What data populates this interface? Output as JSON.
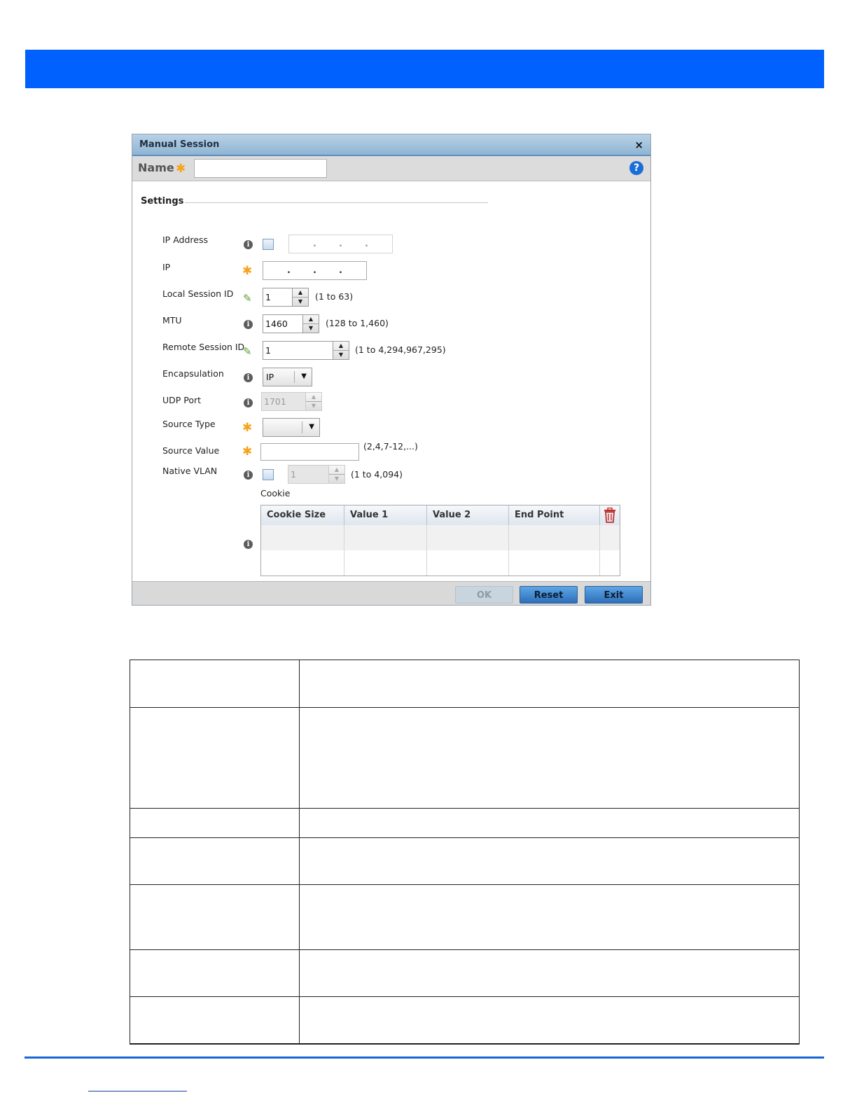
{
  "dialog": {
    "title": "Manual Session",
    "close_glyph": "×",
    "name_label": "Name",
    "name_value": "",
    "help_glyph": "?",
    "settings_label": "Settings"
  },
  "fields": {
    "ip_address": {
      "label": "IP Address",
      "checked": false
    },
    "ip": {
      "label": "IP"
    },
    "local_session_id": {
      "label": "Local Session ID",
      "value": "1",
      "hint": "(1 to 63)"
    },
    "mtu": {
      "label": "MTU",
      "value": "1460",
      "hint": "(128 to 1,460)"
    },
    "remote_session_id": {
      "label": "Remote Session ID",
      "value": "1",
      "hint": "(1 to 4,294,967,295)"
    },
    "encapsulation": {
      "label": "Encapsulation",
      "value": "IP"
    },
    "udp_port": {
      "label": "UDP Port",
      "value": "1701"
    },
    "source_type": {
      "label": "Source Type",
      "value": ""
    },
    "source_value": {
      "label": "Source Value",
      "value": "",
      "hint": "(2,4,7-12,...)"
    },
    "native_vlan": {
      "label": "Native VLAN",
      "value": "1",
      "hint": "(1 to 4,094)",
      "checked": false
    }
  },
  "cookie": {
    "label": "Cookie",
    "columns": [
      "Cookie Size",
      "Value 1",
      "Value 2",
      "End Point"
    ]
  },
  "buttons": {
    "ok": "OK",
    "reset": "Reset",
    "exit": "Exit"
  },
  "icons": {
    "info": "info-icon",
    "mandatory": "asterisk-icon",
    "override": "pencil-override-icon",
    "delete": "trash-icon",
    "help": "help-icon",
    "close": "close-icon"
  },
  "colors": {
    "header_bar": "#0061ff",
    "accent_button": "#2f6fb8",
    "mandatory_star": "#f7a21b",
    "footer_rule": "#1a66d9"
  }
}
